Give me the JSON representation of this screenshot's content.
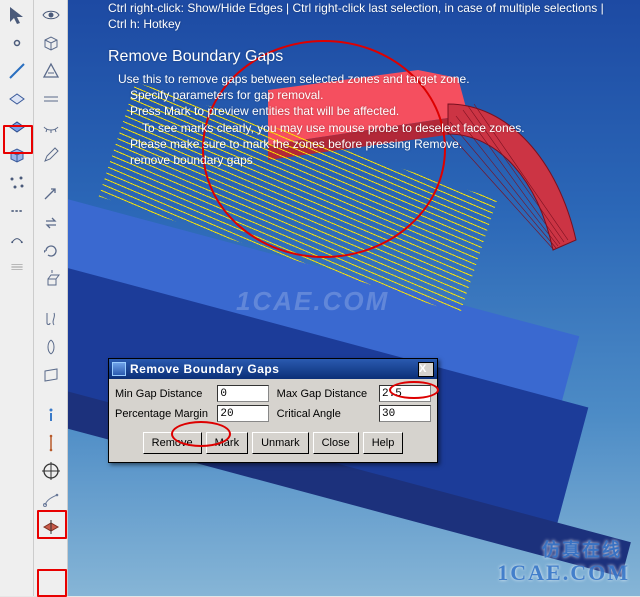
{
  "help": {
    "hint": "Ctrl right-click: Show/Hide Edges | Ctrl right-click last selection, in case of multiple selections | Ctrl h: Hotkey",
    "title": "Remove Boundary Gaps",
    "l1a": "Use this to remove gaps between selected zones and target zone.",
    "l2a": "Specify parameters for gap removal.",
    "l2b": "Press Mark to preview entities that will be affected.",
    "l3a": "To see marks clearly, you may use mouse probe to deselect face zones.",
    "l2c": "Please make sure to mark the zones before pressing Remove.",
    "l2d": "remove boundary gaps"
  },
  "dialog": {
    "title": "Remove Boundary Gaps",
    "labels": {
      "min_gap": "Min Gap Distance",
      "max_gap": "Max Gap Distance",
      "pct": "Percentage Margin",
      "angle": "Critical Angle"
    },
    "values": {
      "min_gap": "0",
      "max_gap": "2.5",
      "pct": "20",
      "angle": "30"
    },
    "buttons": {
      "remove": "Remove",
      "mark": "Mark",
      "unmark": "Unmark",
      "close": "Close",
      "help": "Help"
    },
    "close_x": "X"
  },
  "watermark": {
    "center": "1CAE.COM",
    "corner_en": "1CAE.COM",
    "corner_cn": "仿真在线"
  },
  "tool_names": {
    "c1": [
      "cursor",
      "point",
      "edge",
      "face",
      "zone",
      "cube",
      "nodes",
      "sep",
      "handle",
      "line-sep",
      "sep2"
    ],
    "c2": [
      "view",
      "wireframe",
      "shaded",
      "hidden",
      "eye",
      "pencil",
      "sep",
      "move",
      "swap",
      "rotate",
      "extrude",
      "sep2",
      "trim",
      "project",
      "sweep",
      "sep3",
      "info",
      "axis",
      "target",
      "probe",
      "slice"
    ]
  }
}
